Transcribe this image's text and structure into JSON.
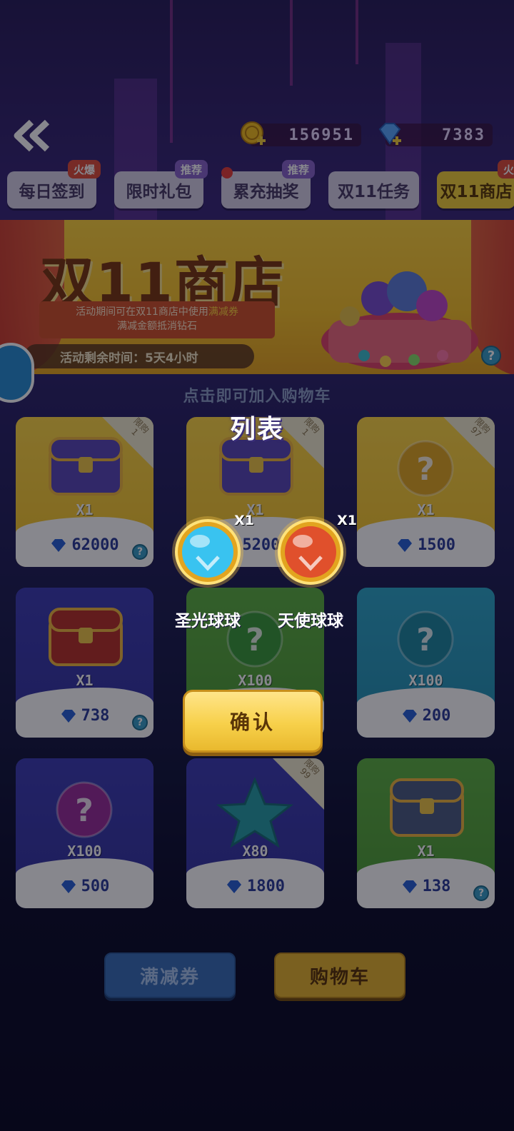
{
  "header": {
    "back_icon": "double-chevron-left-icon",
    "coins": {
      "icon": "gold-coin-icon",
      "value": "156951"
    },
    "diamonds": {
      "icon": "diamond-icon",
      "value": "7383"
    }
  },
  "tabs": [
    {
      "label": "每日签到",
      "badge": "火爆",
      "badge_type": "hot",
      "active": false,
      "dot": false
    },
    {
      "label": "限时礼包",
      "badge": "推荐",
      "badge_type": "rec",
      "active": false,
      "dot": false
    },
    {
      "label": "累充抽奖",
      "badge": "推荐",
      "badge_type": "rec",
      "active": false,
      "dot": true
    },
    {
      "label": "双11任务",
      "badge": "",
      "badge_type": "",
      "active": false,
      "dot": false
    },
    {
      "label": "双11商店",
      "badge": "火",
      "badge_type": "hot",
      "active": true,
      "dot": false
    }
  ],
  "banner": {
    "title": "双11商店",
    "note_line1_pre": "活动期间可在双11商店中使用",
    "note_line1_highlight": "满减券",
    "note_line2": "满减金额抵消钻石",
    "remaining": "活动剩余时间：5天4小时"
  },
  "hint": "点击即可加入购物车",
  "shop_items": [
    {
      "qty": "X1",
      "price": "62000",
      "limit": "限购\n1",
      "color": "#ffd845",
      "art": "treasure-chest-orbs-icon",
      "help": true
    },
    {
      "qty": "X1",
      "price": "52000",
      "limit": "限购\n1",
      "color": "#ffd845",
      "art": "treasure-chest-orbs-icon",
      "help": false
    },
    {
      "qty": "X1",
      "price": "1500",
      "limit": "限购\n97",
      "color": "#ffd845",
      "art": "mystery-orb-gold-icon",
      "help": false
    },
    {
      "qty": "X1",
      "price": "738",
      "limit": "",
      "color": "#3f3fb4",
      "art": "red-chest-icon",
      "help": true
    },
    {
      "qty": "X100",
      "price": "",
      "limit": "",
      "color": "#5fb243",
      "art": "mystery-orb-green-icon",
      "help": false
    },
    {
      "qty": "X100",
      "price": "200",
      "limit": "",
      "color": "#2fa8c9",
      "art": "mystery-orb-teal-icon",
      "help": false
    },
    {
      "qty": "X100",
      "price": "500",
      "limit": "",
      "color": "#3f3fb4",
      "art": "mystery-orb-purple-icon",
      "help": false
    },
    {
      "qty": "X80",
      "price": "1800",
      "limit": "限购\n99",
      "color": "#3f3fb4",
      "art": "star-icon",
      "help": false
    },
    {
      "qty": "X1",
      "price": "138",
      "limit": "",
      "color": "#5fb243",
      "art": "silver-chest-icon",
      "help": true
    }
  ],
  "modal": {
    "title": "列表",
    "rewards": [
      {
        "name": "圣光球球",
        "qty": "X1",
        "icon": "holy-light-orb-icon",
        "color": "#39c3f0"
      },
      {
        "name": "天使球球",
        "qty": "X1",
        "icon": "angel-orb-icon",
        "color": "#e0502c"
      }
    ],
    "confirm_label": "确认"
  },
  "footer": {
    "coupon_label": "满减券",
    "cart_label": "购物车"
  }
}
